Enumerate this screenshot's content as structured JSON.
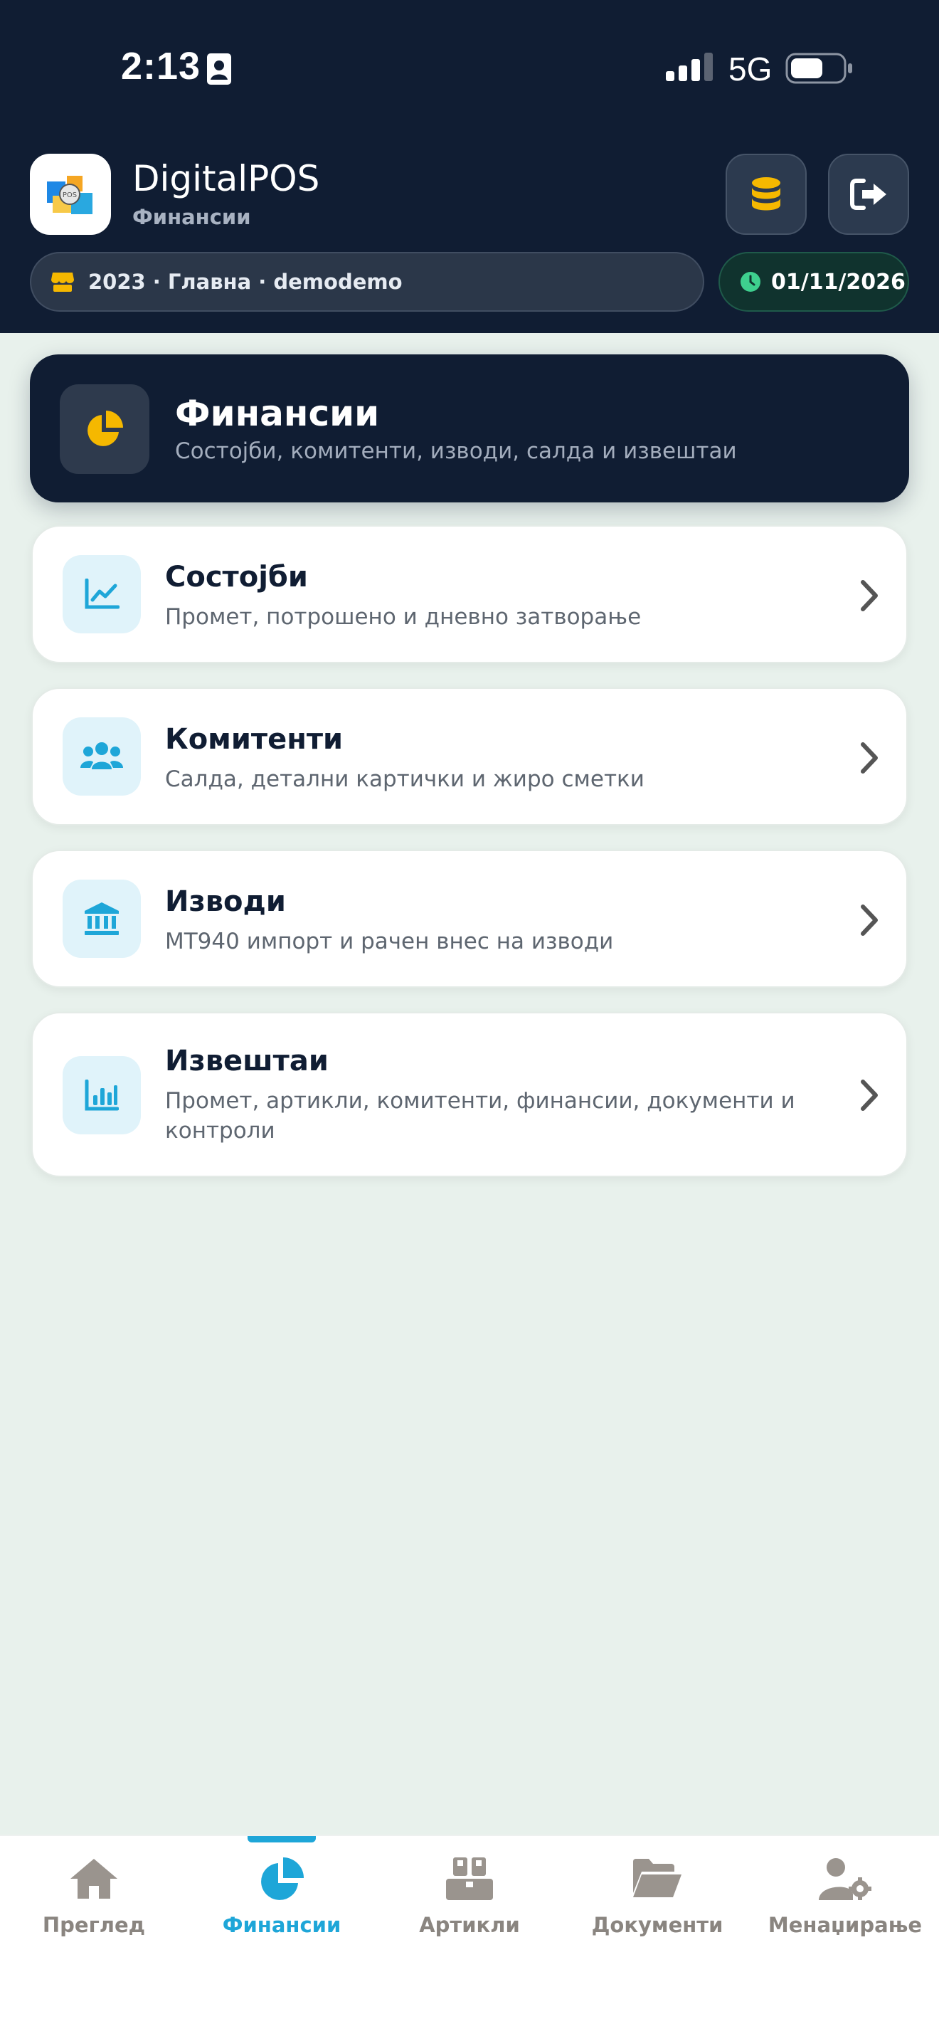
{
  "status_bar": {
    "time": "2:13",
    "network": "5G"
  },
  "header": {
    "app_name": "DigitalPOS",
    "section": "Финансии",
    "company": "2023 · Главна · demodemo",
    "date": "01/11/2026"
  },
  "hero": {
    "title": "Финансии",
    "subtitle": "Состојби, комитенти, изводи, салда и извештаи"
  },
  "cards": [
    {
      "title": "Состојби",
      "subtitle": "Промет, потрошено и дневно затворање",
      "icon": "chart-line-icon"
    },
    {
      "title": "Комитенти",
      "subtitle": "Салда, детални картички и жиро сметки",
      "icon": "users-icon"
    },
    {
      "title": "Изводи",
      "subtitle": "MT940 импорт и рачен внес на изводи",
      "icon": "bank-icon"
    },
    {
      "title": "Извештаи",
      "subtitle": "Промет, артикли, комитенти, финансии, документи и контроли",
      "icon": "bar-chart-icon"
    }
  ],
  "tabs": [
    {
      "label": "Преглед",
      "icon": "home-icon"
    },
    {
      "label": "Финансии",
      "icon": "pie-chart-icon",
      "active": true
    },
    {
      "label": "Артикли",
      "icon": "boxes-icon"
    },
    {
      "label": "Документи",
      "icon": "folder-icon"
    },
    {
      "label": "Менаџирање",
      "icon": "user-gear-icon"
    }
  ],
  "colors": {
    "header_bg": "#101d33",
    "accent": "#1ea6d8",
    "gold": "#f5b800",
    "page_bg": "#e8f1ec",
    "date_green": "#3ecf8e"
  }
}
